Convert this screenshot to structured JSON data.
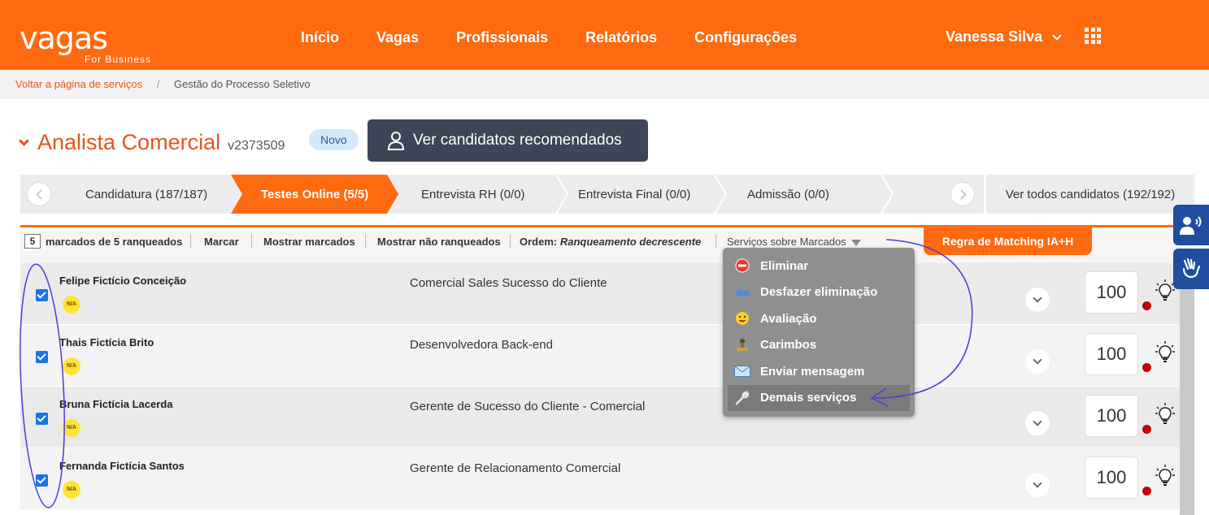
{
  "header": {
    "logo_text": "vagas",
    "logo_sub": "For Business",
    "nav": [
      "Início",
      "Vagas",
      "Profissionais",
      "Relatórios",
      "Configurações"
    ],
    "user_name": "Vanessa Silva"
  },
  "breadcrumb": {
    "back": "Voltar a página de serviços",
    "separator": "/",
    "current": "Gestão do Processo Seletivo"
  },
  "job": {
    "title": "Analista Comercial",
    "code": "v2373509",
    "badge": "Novo",
    "recommend_button": "Ver candidatos recomendados"
  },
  "stepper": {
    "steps": [
      "Candidatura (187/187)",
      "Testes Online (5/5)",
      "Entrevista RH (0/0)",
      "Entrevista Final (0/0)",
      "Admissão (0/0)"
    ],
    "active_index": 1,
    "view_all": "Ver todos candidatos (192/192)"
  },
  "toolbar": {
    "count": "5",
    "marked_text": "marcados de 5 ranqueados",
    "mark": "Marcar",
    "show_marked": "Mostrar marcados",
    "show_unranked": "Mostrar não ranqueados",
    "order_label": "Ordem:",
    "order_value": "Ranqueamento decrescente",
    "services": "Serviços sobre Marcados",
    "matching_button": "Regra de Matching IA+H"
  },
  "dropdown": {
    "items": [
      {
        "label": "Eliminar",
        "icon": "eliminate-icon"
      },
      {
        "label": "Desfazer eliminação",
        "icon": "undo-icon"
      },
      {
        "label": "Avaliação",
        "icon": "smiley-icon"
      },
      {
        "label": "Carimbos",
        "icon": "stamp-icon"
      },
      {
        "label": "Enviar mensagem",
        "icon": "envelope-icon"
      },
      {
        "label": "Demais serviços",
        "icon": "wrench-icon"
      }
    ]
  },
  "candidates": [
    {
      "name": "Felipe Fictício Conceição",
      "badge": "N/A",
      "job": "Comercial Sales Sucesso do Cliente",
      "score": "100",
      "checked": true
    },
    {
      "name": "Thais Fictícia Brito",
      "badge": "N/A",
      "job": "Desenvolvedora Back-end",
      "score": "100",
      "checked": true
    },
    {
      "name": "Bruna Fictícia Lacerda",
      "badge": "N/A",
      "job": "Gerente de Sucesso do Cliente - Comercial",
      "score": "100",
      "checked": true
    },
    {
      "name": "Fernanda Fictícia Santos",
      "badge": "N/A",
      "job": "Gerente de Relacionamento Comercial",
      "score": "100",
      "checked": true
    }
  ],
  "colors": {
    "brand_orange": "#fe6a0f",
    "dark_button": "#3d4656",
    "accessibility_blue": "#1f4ea0"
  }
}
